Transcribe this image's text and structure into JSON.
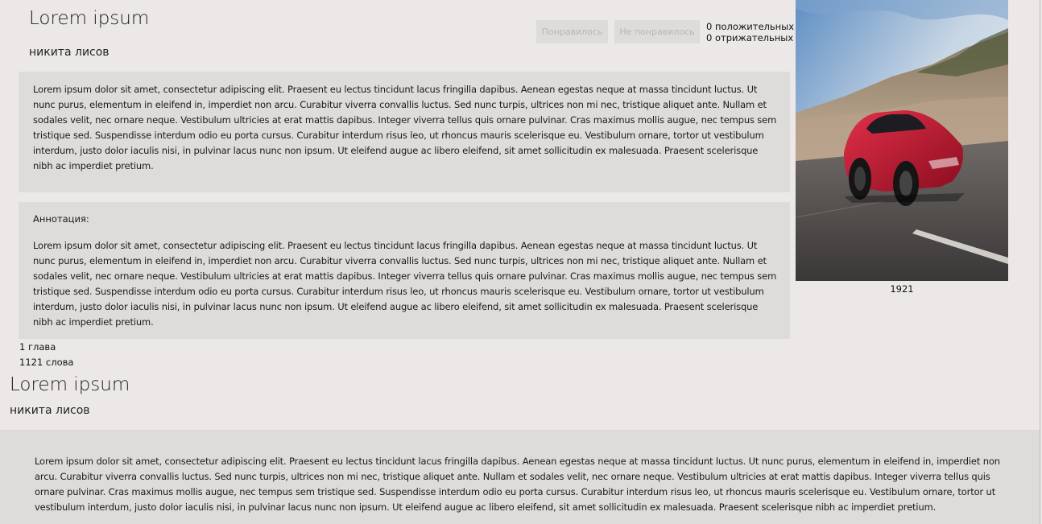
{
  "books": [
    {
      "title": "Lorem ipsum",
      "author": "никита лисов",
      "like_label": "Понравилось",
      "dislike_label": "Не понравилось",
      "positive": "0 положительных",
      "negative": "0 отрижательных",
      "description": "Lorem ipsum dolor sit amet, consectetur adipiscing elit. Praesent eu lectus tincidunt lacus fringilla dapibus. Aenean egestas neque at massa tincidunt luctus. Ut nunc purus, elementum in eleifend in, imperdiet non arcu. Curabitur viverra convallis luctus. Sed nunc turpis, ultrices non mi nec, tristique aliquet ante. Nullam et sodales velit, nec ornare neque. Vestibulum ultricies at erat mattis dapibus. Integer viverra tellus quis ornare pulvinar. Cras maximus mollis augue, nec tempus sem tristique sed. Suspendisse interdum odio eu porta cursus. Curabitur interdum risus leo, ut rhoncus mauris scelerisque eu. Vestibulum ornare, tortor ut vestibulum interdum, justo dolor iaculis nisi, in pulvinar lacus nunc non ipsum. Ut eleifend augue ac libero eleifend, sit amet sollicitudin ex malesuada. Praesent scelerisque nibh ac imperdiet pretium.",
      "annotation_label": "Аннотация:",
      "annotation": "Lorem ipsum dolor sit amet, consectetur adipiscing elit. Praesent eu lectus tincidunt lacus fringilla dapibus. Aenean egestas neque at massa tincidunt luctus. Ut nunc purus, elementum in eleifend in, imperdiet non arcu. Curabitur viverra convallis luctus. Sed nunc turpis, ultrices non mi nec, tristique aliquet ante. Nullam et sodales velit, nec ornare neque. Vestibulum ultricies at erat mattis dapibus. Integer viverra tellus quis ornare pulvinar. Cras maximus mollis augue, nec tempus sem tristique sed. Suspendisse interdum odio eu porta cursus. Curabitur interdum risus leo, ut rhoncus mauris scelerisque eu. Vestibulum ornare, tortor ut vestibulum interdum, justo dolor iaculis nisi, in pulvinar lacus nunc non ipsum. Ut eleifend augue ac libero eleifend, sit amet sollicitudin ex malesuada. Praesent scelerisque nibh ac imperdiet pretium.",
      "year": "1921",
      "chapters": "1 глава",
      "words": "1121 слова"
    },
    {
      "title": "Lorem ipsum",
      "author": "никита лисов",
      "description": "Lorem ipsum dolor sit amet, consectetur adipiscing elit. Praesent eu lectus tincidunt lacus fringilla dapibus. Aenean egestas neque at massa tincidunt luctus. Ut nunc purus, elementum in eleifend in, imperdiet non arcu. Curabitur viverra convallis luctus. Sed nunc turpis, ultrices non mi nec, tristique aliquet ante. Nullam et sodales velit, nec ornare neque. Vestibulum ultricies at erat mattis dapibus. Integer viverra tellus quis ornare pulvinar. Cras maximus mollis augue, nec tempus sem tristique sed. Suspendisse interdum odio eu porta cursus. Curabitur interdum risus leo, ut rhoncus mauris scelerisque eu. Vestibulum ornare, tortor ut vestibulum interdum, justo dolor iaculis nisi, in pulvinar lacus nunc non ipsum. Ut eleifend augue ac libero eleifend, sit amet sollicitudin ex malesuada. Praesent scelerisque nibh ac imperdiet pretium."
    }
  ],
  "colors": {
    "page_bg": "#ece8e8",
    "box_bg": "#dedbdb",
    "button_text": "#b8b5b5",
    "car_red": "#c0182e"
  },
  "cover_image": "red-sports-car-icon"
}
